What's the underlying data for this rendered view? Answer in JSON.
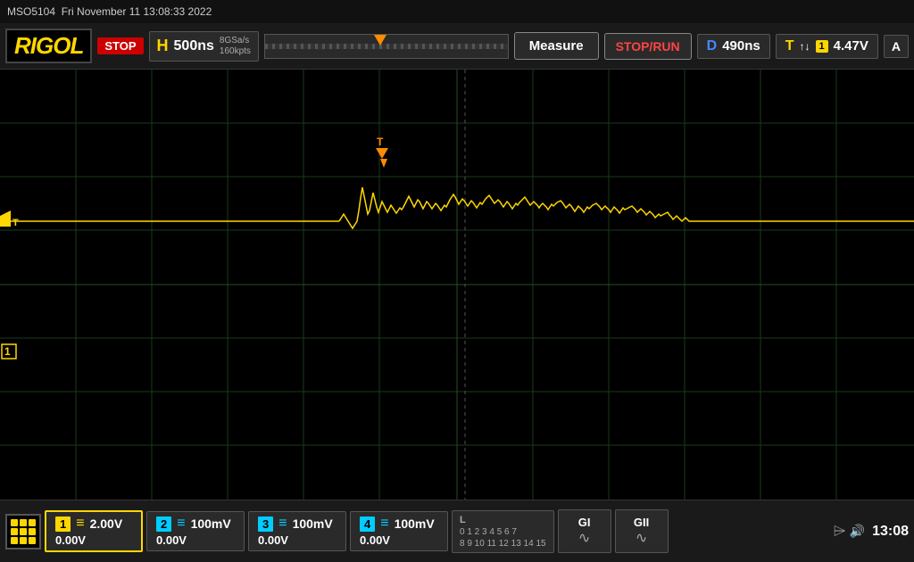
{
  "topbar": {
    "device": "MSO5104",
    "datetime": "Fri November 11  13:08:33 2022"
  },
  "toolbar": {
    "logo": "RIGOL",
    "status": "STOP",
    "h_label": "H",
    "h_value": "500ns",
    "h_sample_rate": "8GSa/s",
    "h_mem_depth": "160kpts",
    "trigger_bar_label": "trigger position bar",
    "measure_label": "Measure",
    "stop_run_label": "STOP/RUN",
    "d_label": "D",
    "d_value": "490ns",
    "t_label": "T",
    "t_arrows": "↑↓",
    "t_ch_badge": "1",
    "t_volt": "4.47V",
    "t_end": "A"
  },
  "scope": {
    "trigger_ch_label": "T",
    "ch1_scope_label": "1",
    "grid_divisions_h": 12,
    "grid_divisions_v": 8
  },
  "bottombar": {
    "ch1_num": "1",
    "ch1_volt": "2.00V",
    "ch1_offset": "0.00V",
    "ch2_num": "2",
    "ch2_volt": "100mV",
    "ch2_offset": "0.00V",
    "ch3_num": "3",
    "ch3_volt": "100mV",
    "ch3_offset": "0.00V",
    "ch4_num": "4",
    "ch4_volt": "100mV",
    "ch4_offset": "0.00V",
    "l_row1": "0 1 2 3 4 5 6 7",
    "l_row2": "8 9 10 11 12 13 14 15",
    "gi_label": "GI",
    "gi2_label": "GII",
    "time": "13:08"
  },
  "colors": {
    "ch1": "#FFD700",
    "ch2": "#00ccff",
    "accent": "#FF8C00",
    "stop_red": "#cc0000",
    "background": "#000000",
    "grid": "#1a3a1a"
  }
}
